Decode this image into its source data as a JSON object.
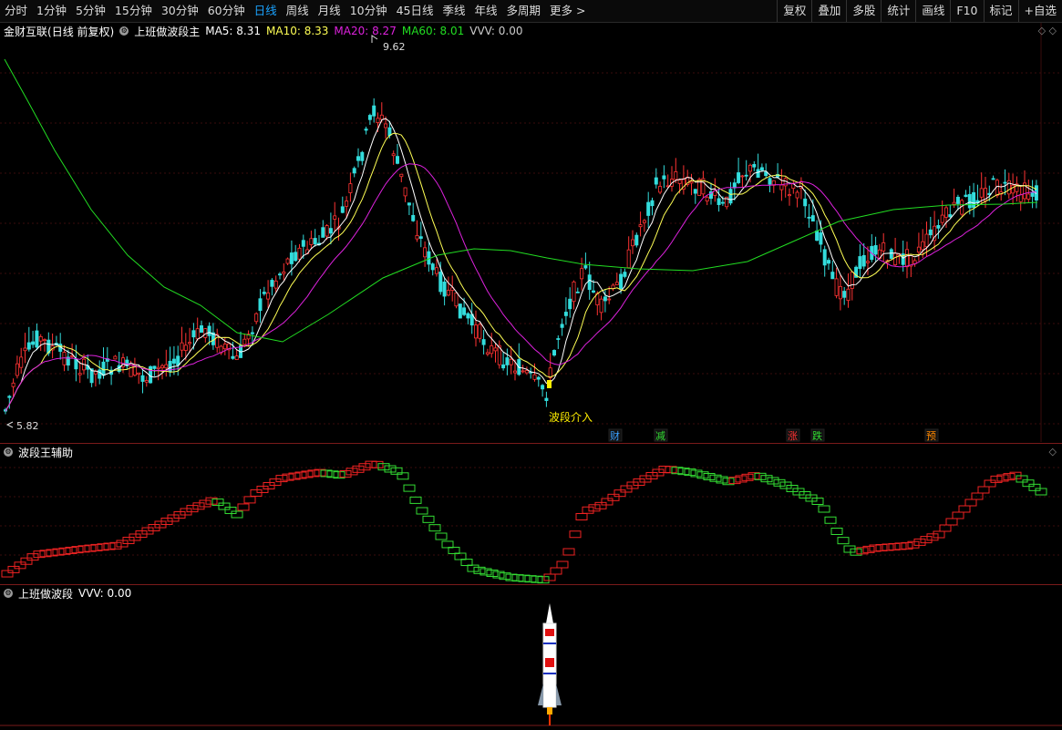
{
  "toolbar": {
    "periods": [
      "分时",
      "1分钟",
      "5分钟",
      "15分钟",
      "30分钟",
      "60分钟",
      "日线",
      "周线",
      "月线",
      "10分钟",
      "45日线",
      "季线",
      "年线",
      "多周期",
      "更多 >"
    ],
    "active_period": "日线",
    "tools": [
      "复权",
      "叠加",
      "多股",
      "统计",
      "画线",
      "F10",
      "标记",
      "+自选"
    ]
  },
  "main": {
    "stock": "金财互联",
    "mode": "(日线 前复权)",
    "indicator": "上班做波段主",
    "ma5": "MA5: 8.31",
    "ma10": "MA10: 8.33",
    "ma20": "MA20: 8.27",
    "ma60": "MA60: 8.01",
    "vvv": "VVV: 0.00",
    "high_label": "9.62",
    "low_label": "5.82",
    "signal": "波段介入",
    "markers": [
      {
        "text": "财",
        "color": "#3aa0ff"
      },
      {
        "text": "减",
        "color": "#33dd33"
      },
      {
        "text": "涨",
        "color": "#ff3333"
      },
      {
        "text": "跌",
        "color": "#33dd33"
      },
      {
        "text": "预",
        "color": "#ff8800"
      }
    ]
  },
  "aux": {
    "title": "波段王辅助"
  },
  "bottom": {
    "title": "上班做波段",
    "vvv": "VVV: 0.00"
  },
  "colors": {
    "up": "#ff3333",
    "down": "#33dddd",
    "ma5": "#ffffff",
    "ma10": "#ffff55",
    "ma20": "#dd22dd",
    "ma60": "#22dd22",
    "active": "#1aa3ff"
  }
}
